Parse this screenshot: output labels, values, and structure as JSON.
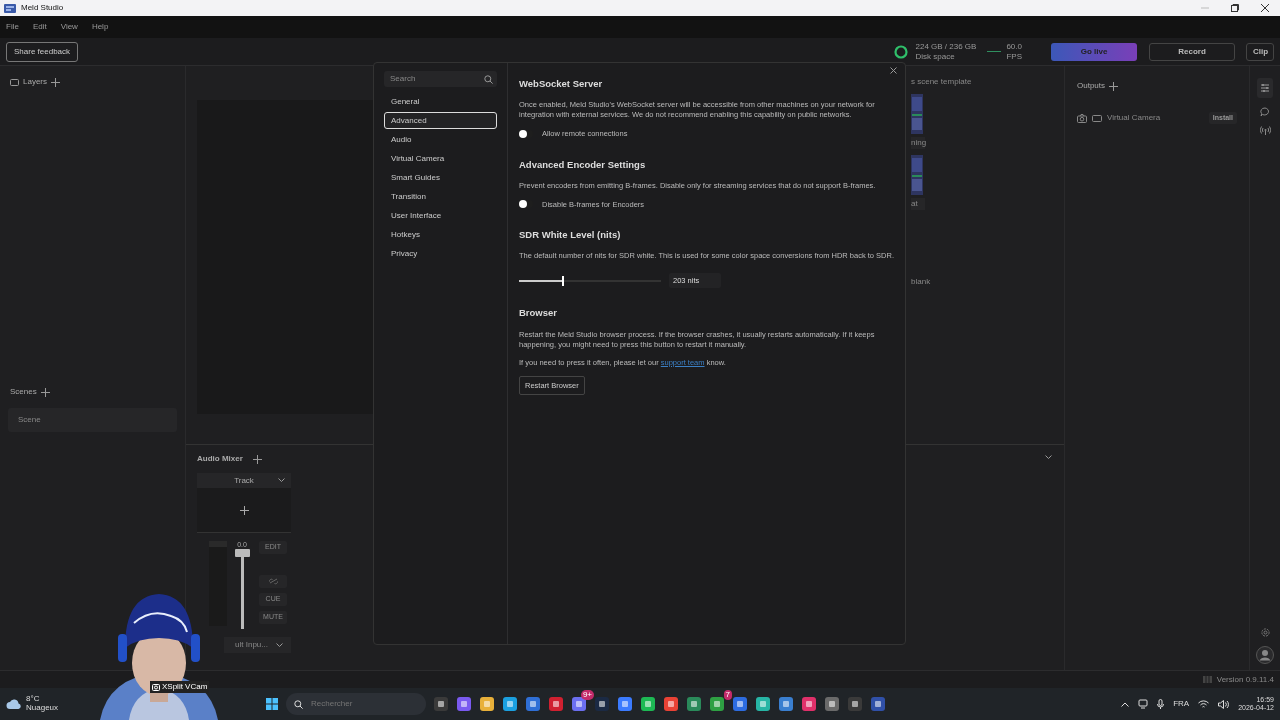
{
  "window": {
    "title": "Meld Studio"
  },
  "menu": [
    "File",
    "Edit",
    "View",
    "Help"
  ],
  "toolbar": {
    "feedback": "Share feedback",
    "disk": {
      "reading": "224 GB / 236 GB",
      "label": "Disk space"
    },
    "fps": {
      "reading": "60.0",
      "label": "FPS"
    },
    "buttons": [
      {
        "label": "Go live",
        "kind": "live"
      },
      {
        "label": "Record",
        "kind": "wide"
      },
      {
        "label": "Clip",
        "kind": "small"
      }
    ]
  },
  "layers": {
    "title": "Layers"
  },
  "scenes": {
    "title": "Scenes",
    "items": [
      "Scene"
    ]
  },
  "templates": [
    {
      "kind": "heading",
      "label": "s scene template"
    },
    {
      "kind": "card",
      "label": "ning"
    },
    {
      "kind": "card",
      "label": "at"
    },
    {
      "kind": "option",
      "label": "blank"
    }
  ],
  "audio_mixer": {
    "title": "Audio Mixer",
    "track": "Track",
    "fader_reading": "0.0",
    "level": 1,
    "buttons": [
      "EDIT",
      "CUE",
      "MUTE"
    ],
    "input": "ult Inpu..."
  },
  "outputs": {
    "title": "Outputs",
    "items": [
      {
        "label": "Virtual Camera",
        "action": "Install"
      }
    ]
  },
  "status_bar": {
    "version": "Version 0.9.11.4"
  },
  "settings": {
    "search": {
      "placeholder": "Search"
    },
    "nav": [
      {
        "label": "General",
        "selected": false
      },
      {
        "label": "Advanced",
        "selected": true
      },
      {
        "label": "Audio",
        "selected": false
      },
      {
        "label": "Virtual Camera",
        "selected": false
      },
      {
        "label": "Smart Guides",
        "selected": false
      },
      {
        "label": "Transition",
        "selected": false
      },
      {
        "label": "User Interface",
        "selected": false
      },
      {
        "label": "Hotkeys",
        "selected": false
      },
      {
        "label": "Privacy",
        "selected": false
      }
    ],
    "sections": [
      {
        "title": "WebSocket Server",
        "items": [
          {
            "kind": "text",
            "text": "Once enabled, Meld Studio's WebSocket server will be accessible from other machines on your network for integration with external services. We do not recommend enabling this capability on public networks."
          },
          {
            "kind": "toggle",
            "label": "Allow remote connections",
            "on": false
          }
        ]
      },
      {
        "title": "Advanced Encoder Settings",
        "items": [
          {
            "kind": "text",
            "text": "Prevent encoders from emitting B-frames. Disable only for streaming services that do not support B-frames."
          },
          {
            "kind": "toggle",
            "label": "Disable B-frames for Encoders",
            "on": false
          }
        ]
      },
      {
        "title": "SDR White Level (nits)",
        "items": [
          {
            "kind": "text",
            "text": "The default number of nits for SDR white. This is used for some color space conversions from HDR back to SDR."
          },
          {
            "kind": "slider",
            "level": 0.3,
            "reading": "203 nits"
          }
        ]
      },
      {
        "title": "Browser",
        "items": [
          {
            "kind": "text",
            "text": "Restart the Meld Studio browser process. If the browser crashes, it usually restarts automatically. If it keeps happening, you might need to press this button to restart it manually."
          },
          {
            "kind": "link_text",
            "before": "If you need to press it often, please let our",
            "link": "support team",
            "after": "know."
          },
          {
            "kind": "button",
            "label": "Restart Browser"
          }
        ]
      }
    ]
  },
  "webcam": {
    "kind": "picture",
    "label": "XSplit VCam"
  },
  "taskbar": {
    "weather": {
      "temp": "8°C",
      "desc": "Nuageux"
    },
    "search": {
      "placeholder": "Rechercher"
    },
    "apps": [
      {
        "color": "#3a3a3a"
      },
      {
        "color": "#7a5af0"
      },
      {
        "color": "#e8b03a"
      },
      {
        "color": "#1ba0e0"
      },
      {
        "color": "#2f6fd6"
      },
      {
        "color": "#d02030"
      },
      {
        "color": "#6b6ff0",
        "badge": "9+"
      },
      {
        "color": "#1b2a44"
      },
      {
        "color": "#3b7bff"
      },
      {
        "color": "#1db954"
      },
      {
        "color": "#e94235"
      },
      {
        "color": "#2a8a5a"
      },
      {
        "color": "#2ea043",
        "badge": "7"
      },
      {
        "color": "#2d6ce0"
      },
      {
        "color": "#27b5a5"
      },
      {
        "color": "#3a7fd0"
      },
      {
        "color": "#e0306a"
      },
      {
        "color": "#6a6a6a"
      },
      {
        "color": "#3a3a3a"
      },
      {
        "color": "#3050a8"
      }
    ],
    "tray": {
      "language": "FRA",
      "time": "16:59",
      "date": "2026-04-12"
    }
  }
}
